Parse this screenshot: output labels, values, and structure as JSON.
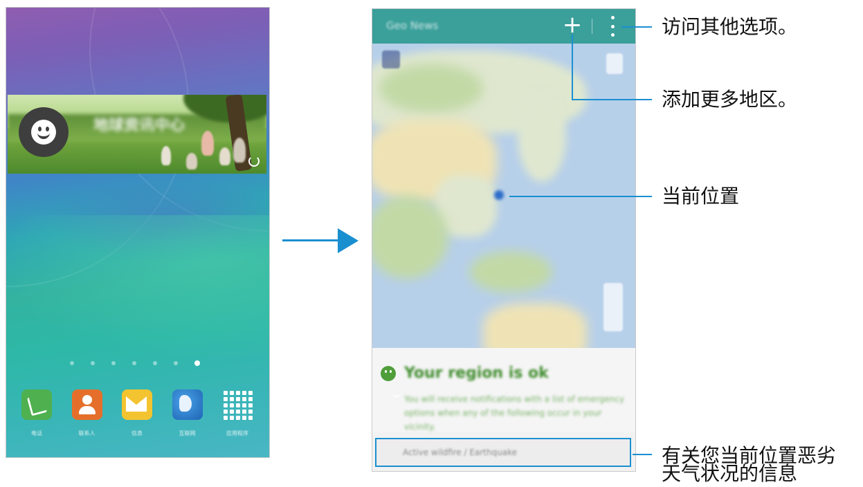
{
  "home_screen": {
    "banner_title": "地球资讯中心",
    "page_dots": {
      "count": 7,
      "active_index": 6
    },
    "dock_apps": [
      {
        "label": "电话",
        "icon": "phone-icon"
      },
      {
        "label": "联系人",
        "icon": "contacts-icon"
      },
      {
        "label": "信息",
        "icon": "messages-icon"
      },
      {
        "label": "互联网",
        "icon": "internet-icon"
      },
      {
        "label": "应用程序",
        "icon": "apps-grid-icon"
      }
    ]
  },
  "geo_news": {
    "app_title": "Geo News",
    "add_symbol": "+",
    "status_headline": "Your region is ok",
    "status_body": "You will receive notifications with a list of emergency options when any of the following occur in your vicinity.",
    "alert_item": "Active wildfire / Earthquake"
  },
  "callouts": {
    "more_options": "访问其他选项。",
    "add_regions": "添加更多地区。",
    "current_location": "当前位置",
    "severe_weather_line1": "有关您当前位置恶劣",
    "severe_weather_line2": "天气状况的信息"
  },
  "colors": {
    "accent_blue": "#1a8fd0",
    "geo_news_bar": "#3b9f9a",
    "ok_green": "#4f9e3a"
  }
}
